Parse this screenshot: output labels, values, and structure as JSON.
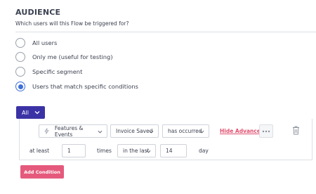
{
  "section": {
    "title": "AUDIENCE",
    "subtitle": "Which users will this Flow be triggered for?"
  },
  "options": [
    {
      "label": "All users",
      "checked": false
    },
    {
      "label": "Only me (useful for testing)",
      "checked": false
    },
    {
      "label": "Specific segment",
      "checked": false
    },
    {
      "label": "Users that match specific conditions",
      "checked": true
    }
  ],
  "group_operator": "All",
  "condition": {
    "category": "Features & Events",
    "event": "Invoice Saved",
    "verb": "has occurred",
    "hide_advanced": "Hide Advanced",
    "frequency_prefix": "at least",
    "frequency_count": "1",
    "frequency_unit": "times",
    "window": "in the last",
    "window_value": "14",
    "window_unit": "day"
  },
  "add_condition_label": "Add Condition",
  "colors": {
    "accent": "#3d6fdb",
    "operator_button": "#3b33a5",
    "link": "#e04e6e",
    "add_button": "#e55a7c"
  },
  "icons": {
    "category": "bolt-icon",
    "dropdown": "chevron-down-icon",
    "more": "more-dots-icon",
    "delete": "trash-icon"
  }
}
